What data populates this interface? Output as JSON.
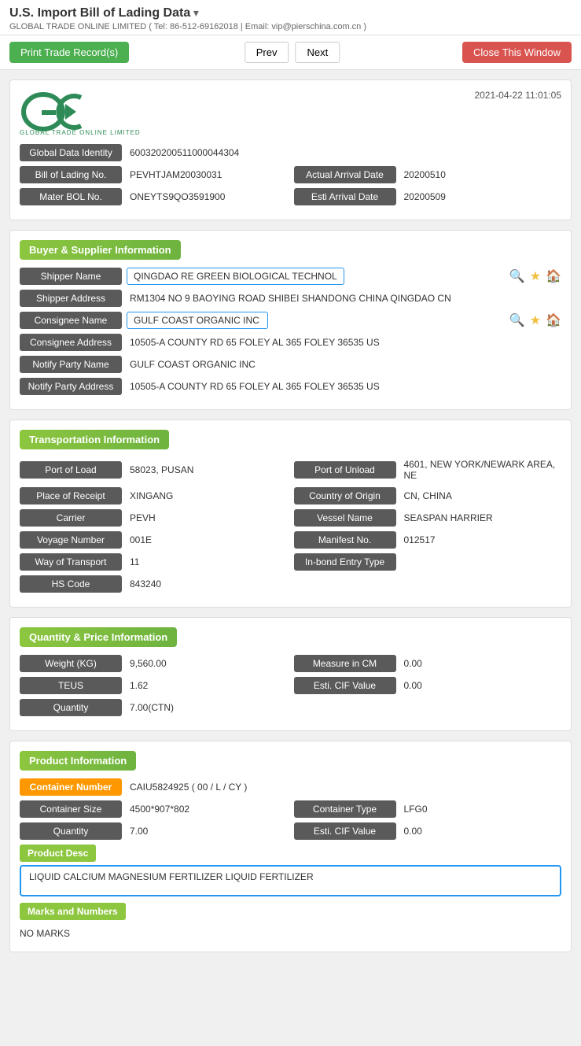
{
  "page": {
    "title": "U.S. Import Bill of Lading Data",
    "subtitle": "GLOBAL TRADE ONLINE LIMITED ( Tel: 86-512-69162018 | Email: vip@pierschina.com.cn )"
  },
  "toolbar": {
    "print_label": "Print Trade Record(s)",
    "prev_label": "Prev",
    "next_label": "Next",
    "close_label": "Close This Window"
  },
  "record": {
    "timestamp": "2021-04-22 11:01:05",
    "global_data_identity": "600320200511000044304",
    "bill_of_lading_no": "PEVHTJAM20030031",
    "actual_arrival_date_label": "Actual Arrival Date",
    "actual_arrival_date": "20200510",
    "mater_bol_no": "ONEYTS9QO3591900",
    "esti_arrival_date_label": "Esti Arrival Date",
    "esti_arrival_date": "20200509"
  },
  "buyer_supplier": {
    "section_title": "Buyer & Supplier Information",
    "shipper_name_label": "Shipper Name",
    "shipper_name": "QINGDAO RE GREEN BIOLOGICAL TECHNOL",
    "shipper_address_label": "Shipper Address",
    "shipper_address": "RM1304 NO 9 BAOYING ROAD SHIBEI SHANDONG CHINA QINGDAO CN",
    "consignee_name_label": "Consignee Name",
    "consignee_name": "GULF COAST ORGANIC INC",
    "consignee_address_label": "Consignee Address",
    "consignee_address": "10505-A COUNTY RD 65 FOLEY AL 365 FOLEY 36535 US",
    "notify_party_name_label": "Notify Party Name",
    "notify_party_name": "GULF COAST ORGANIC INC",
    "notify_party_address_label": "Notify Party Address",
    "notify_party_address": "10505-A COUNTY RD 65 FOLEY AL 365 FOLEY 36535 US"
  },
  "transportation": {
    "section_title": "Transportation Information",
    "port_of_load_label": "Port of Load",
    "port_of_load": "58023, PUSAN",
    "port_of_unload_label": "Port of Unload",
    "port_of_unload": "4601, NEW YORK/NEWARK AREA, NE",
    "place_of_receipt_label": "Place of Receipt",
    "place_of_receipt": "XINGANG",
    "country_of_origin_label": "Country of Origin",
    "country_of_origin": "CN, CHINA",
    "carrier_label": "Carrier",
    "carrier": "PEVH",
    "vessel_name_label": "Vessel Name",
    "vessel_name": "SEASPAN HARRIER",
    "voyage_number_label": "Voyage Number",
    "voyage_number": "001E",
    "manifest_no_label": "Manifest No.",
    "manifest_no": "012517",
    "way_of_transport_label": "Way of Transport",
    "way_of_transport": "11",
    "in_bond_entry_type_label": "In-bond Entry Type",
    "in_bond_entry_type": "",
    "hs_code_label": "HS Code",
    "hs_code": "843240"
  },
  "quantity_price": {
    "section_title": "Quantity & Price Information",
    "weight_kg_label": "Weight (KG)",
    "weight_kg": "9,560.00",
    "measure_in_cm_label": "Measure in CM",
    "measure_in_cm": "0.00",
    "teus_label": "TEUS",
    "teus": "1.62",
    "esti_cif_value_label": "Esti. CIF Value",
    "esti_cif_value": "0.00",
    "quantity_label": "Quantity",
    "quantity": "7.00(CTN)"
  },
  "product": {
    "section_title": "Product Information",
    "container_number_label": "Container Number",
    "container_number": "CAIU5824925 ( 00 / L / CY )",
    "container_size_label": "Container Size",
    "container_size": "4500*907*802",
    "container_type_label": "Container Type",
    "container_type": "LFG0",
    "quantity_label": "Quantity",
    "quantity": "7.00",
    "esti_cif_value_label": "Esti. CIF Value",
    "esti_cif_value": "0.00",
    "product_desc_label": "Product Desc",
    "product_desc": "LIQUID CALCIUM MAGNESIUM FERTILIZER LIQUID FERTILIZER",
    "marks_and_numbers_label": "Marks and Numbers",
    "marks_and_numbers": "NO MARKS"
  }
}
